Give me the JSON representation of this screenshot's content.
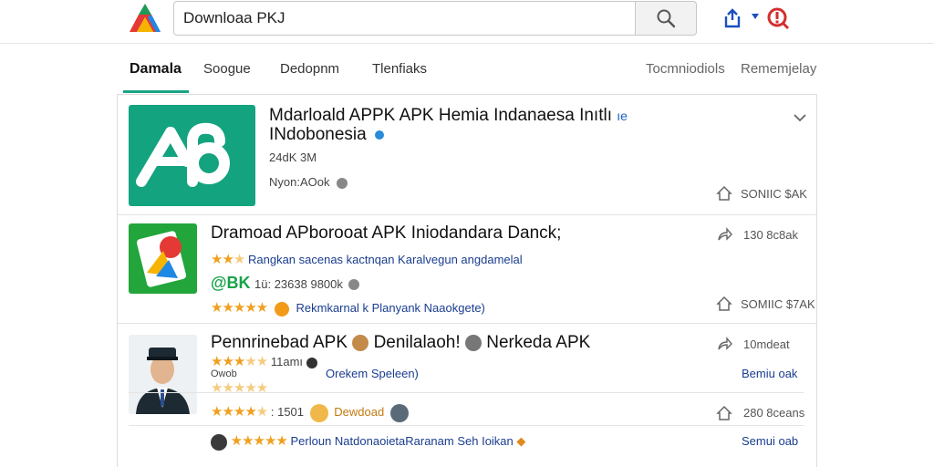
{
  "search": {
    "value": "Downloaa PKJ"
  },
  "tabs": [
    {
      "label": "Damala"
    },
    {
      "label": "Soogue"
    },
    {
      "label": "Dedopnm"
    },
    {
      "label": "Tlenfiaks"
    }
  ],
  "tabs_right": [
    {
      "label": "Tocmniodiols"
    },
    {
      "label": "Rememjelay"
    }
  ],
  "colors": {
    "accent": "#1aa386",
    "link": "#1a3d8f",
    "star": "#f0a020",
    "alert": "#d32f2f"
  },
  "results": [
    {
      "title_line1": "Mdarloald APPK APK Hemia Indanaesa Inıtlı",
      "title_suffix": "ıe",
      "title_line2": "INdobonesia",
      "meta1": "24dK 3M",
      "meta2": "Nyon:AOok",
      "side_bottom": "SONIIC $AK"
    },
    {
      "title": "Dramoad APborooat APK Iniodandara Danck;",
      "rating_stars": 3,
      "description": "Rangkan sacenas kactnqan Karalvegun angdamelal",
      "badge": "@BK",
      "meta": "1ü: 23638 9800k",
      "rating2_stars": 5,
      "extra": "Rekmkarnal k Planyank Naaokgete)",
      "side_top": "130 8c8ak",
      "side_bottom": "SOMIIC $7AK"
    },
    {
      "title_part1": "Pennrinebad APK",
      "title_part2": "Denilalaoh!",
      "title_part3": "Nerkeda APK",
      "rating_stars": 3,
      "meta_a": "11amı",
      "meta_b": "Owob",
      "desc": "Orekem Speleen)",
      "side_top": "10mdeat",
      "side_link": "Bemiu oak",
      "line4_rating_stars": 4,
      "line4_meta": ": 1501",
      "line4_text": "Dewdoad",
      "side_top2": "280 8ceans",
      "line5_rating_stars": 5,
      "line5_text": "Perloun NatdonaoietaRaranam Seh Ioikan",
      "side_link2": "Semui oab"
    }
  ]
}
